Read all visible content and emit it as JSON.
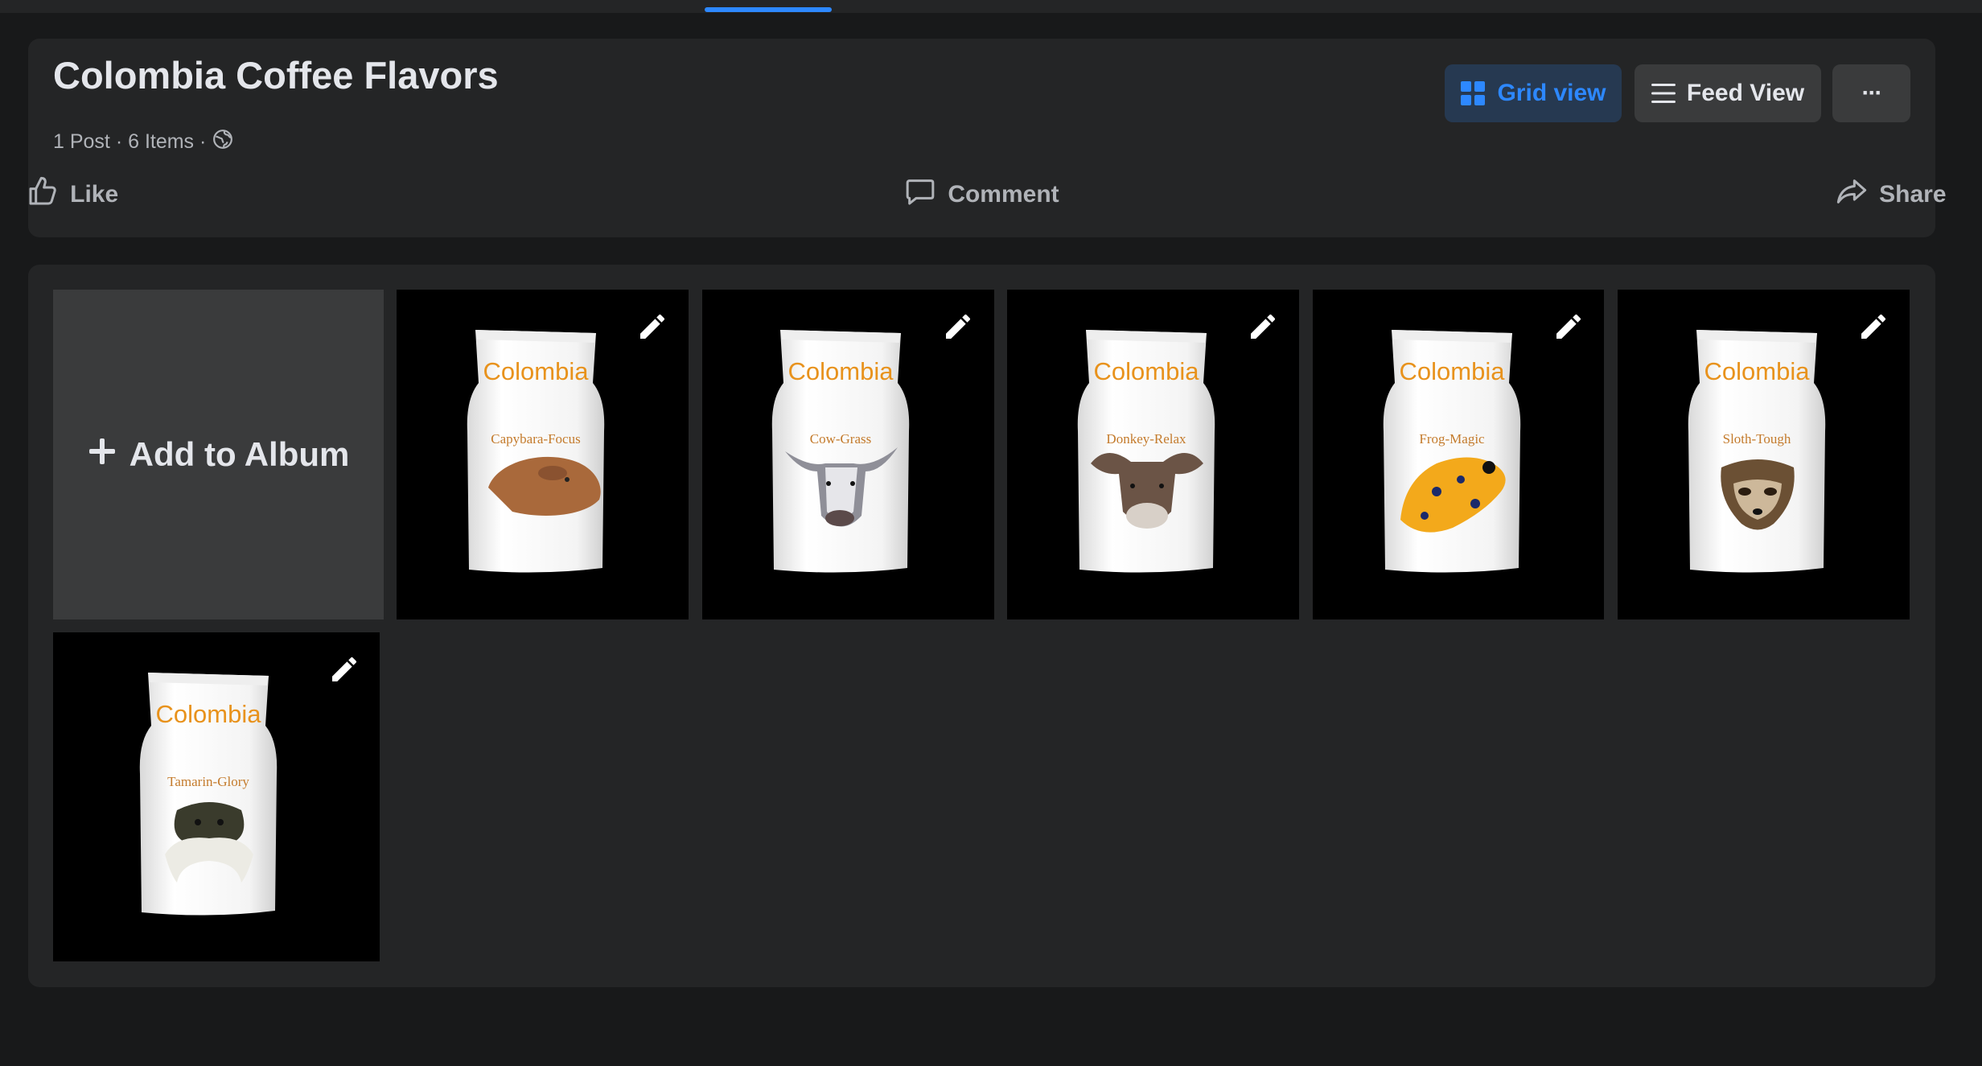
{
  "album": {
    "title": "Colombia Coffee Flavors",
    "meta": "1 Post · 6 Items ·",
    "privacy_icon": "globe-icon"
  },
  "view_buttons": {
    "grid": "Grid view",
    "feed": "Feed View",
    "more": "···"
  },
  "actions": {
    "like": "Like",
    "comment": "Comment",
    "share": "Share"
  },
  "grid": {
    "add_label": "Add to Album",
    "items": [
      {
        "brand": "Colombia",
        "flavor": "Capybara-Focus",
        "animal": "capybara"
      },
      {
        "brand": "Colombia",
        "flavor": "Cow-Grass",
        "animal": "cow"
      },
      {
        "brand": "Colombia",
        "flavor": "Donkey-Relax",
        "animal": "donkey"
      },
      {
        "brand": "Colombia",
        "flavor": "Frog-Magic",
        "animal": "frog"
      },
      {
        "brand": "Colombia",
        "flavor": "Sloth-Tough",
        "animal": "sloth"
      },
      {
        "brand": "Colombia",
        "flavor": "Tamarin-Glory",
        "animal": "tamarin"
      }
    ]
  },
  "colors": {
    "accent": "#2d88ff",
    "brand_text": "#e8921c",
    "card": "#242526",
    "page": "#18191a"
  }
}
